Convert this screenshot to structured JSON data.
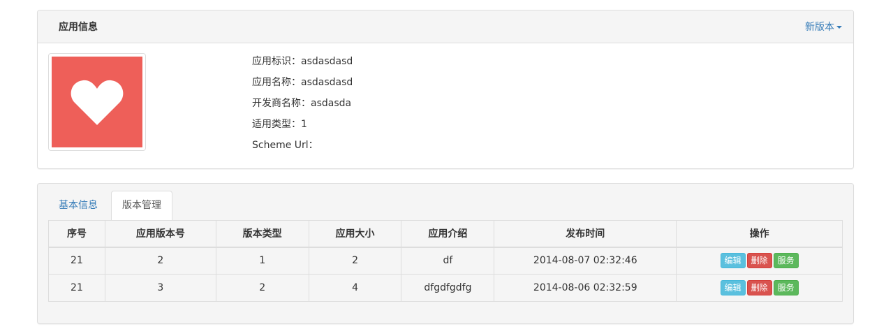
{
  "app_panel": {
    "title": "应用信息",
    "new_version_label": "新版本",
    "icon": "heart-icon",
    "icon_bg_color": "#ee5f59",
    "fields": [
      {
        "label": "应用标识：",
        "value": "asdasdasd"
      },
      {
        "label": "应用名称：",
        "value": "asdasdasd"
      },
      {
        "label": "开发商名称：",
        "value": "asdasda"
      },
      {
        "label": "适用类型：",
        "value": "1"
      },
      {
        "label": "Scheme Url：",
        "value": ""
      }
    ]
  },
  "tabs": [
    {
      "label": "基本信息",
      "active": false
    },
    {
      "label": "版本管理",
      "active": true
    }
  ],
  "table": {
    "headers": [
      "序号",
      "应用版本号",
      "版本类型",
      "应用大小",
      "应用介绍",
      "发布时间",
      "操作"
    ],
    "rows": [
      {
        "cells": [
          "21",
          "2",
          "1",
          "2",
          "df",
          "2014-08-07 02:32:46"
        ]
      },
      {
        "cells": [
          "21",
          "3",
          "2",
          "4",
          "dfgdfgdfg",
          "2014-08-06 02:32:59"
        ]
      }
    ],
    "actions": {
      "edit": "编辑",
      "delete": "删除",
      "service": "服务"
    }
  },
  "colors": {
    "link": "#337ab7",
    "btn_info": "#5bc0de",
    "btn_danger": "#d9534f",
    "btn_success": "#5cb85c"
  }
}
